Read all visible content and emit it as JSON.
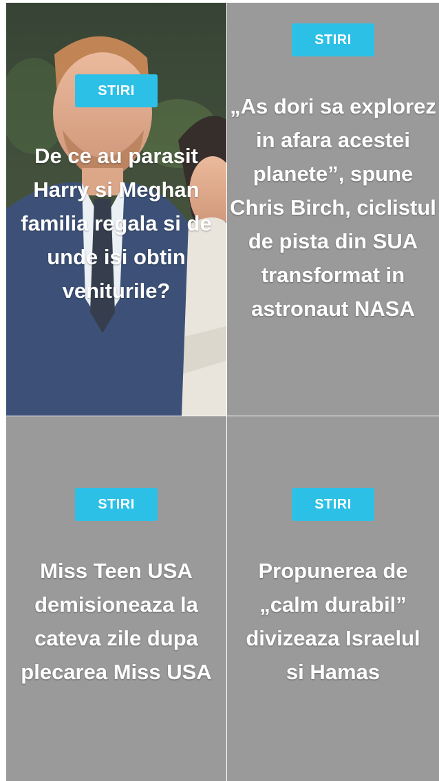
{
  "articles": [
    {
      "category": "STIRI",
      "title": "De ce au parasit Harry si Meghan familia regala si de unde isi obtin veniturile?",
      "image": "harry-and-meghan-photo"
    },
    {
      "category": "STIRI",
      "title": "„As dori sa explorez in afara acestei planete”, spune Chris Birch, ciclistul de pista din SUA transformat in astronaut NASA"
    },
    {
      "category": "STIRI",
      "title": "Miss Teen USA demisioneaza la cateva zile dupa plecarea Miss USA"
    },
    {
      "category": "STIRI",
      "title": "Propunerea de „calm durabil” divizeaza Israelul si Hamas"
    }
  ],
  "colors": {
    "badge": "#2cc0e6",
    "card_background": "#9a9a9a",
    "text": "#ffffff"
  }
}
